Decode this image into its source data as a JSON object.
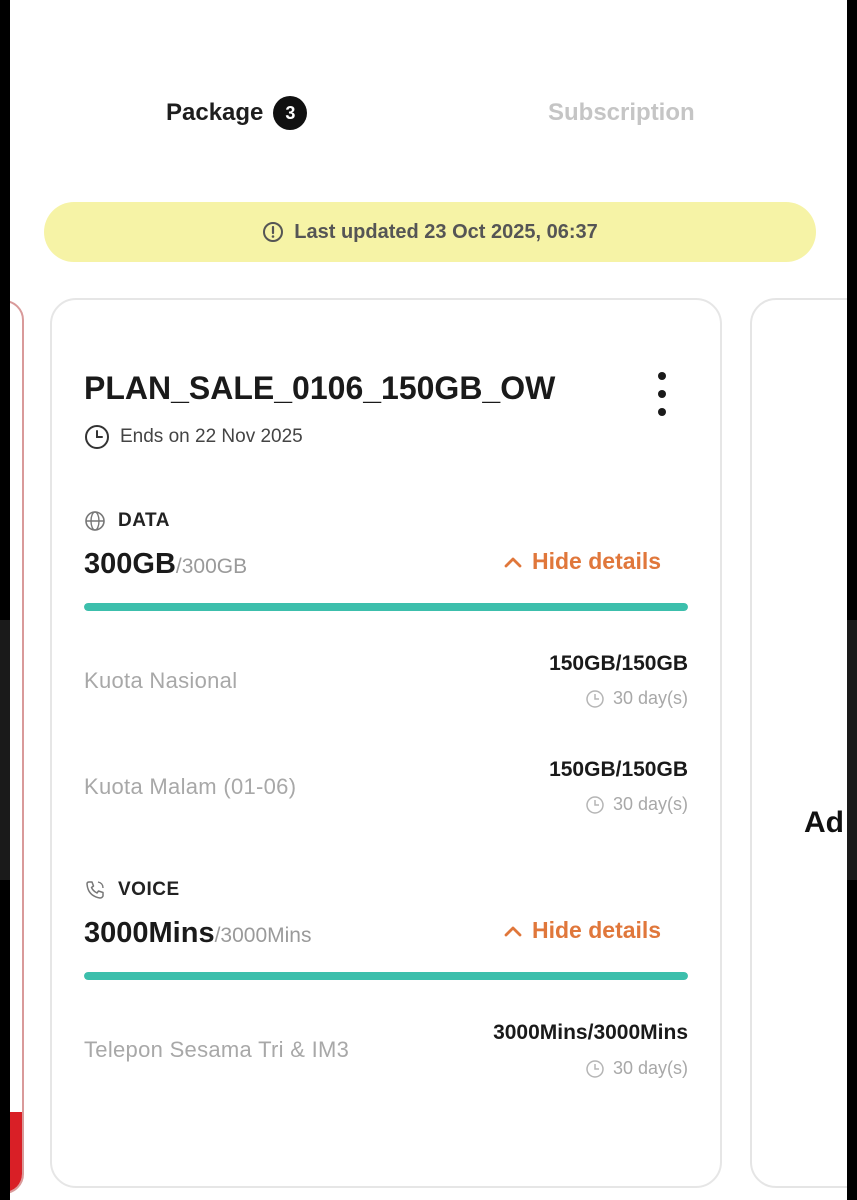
{
  "tabs": {
    "package_label": "Package",
    "package_count": "3",
    "subscription_label": "Subscription"
  },
  "banner": {
    "text": "Last updated 23 Oct 2025, 06:37",
    "icon": "info-icon",
    "color": "#f6f3a6"
  },
  "plan": {
    "name": "PLAN_SALE_0106_150GB_OW",
    "ends": "Ends on 22 Nov 2025",
    "data": {
      "title": "DATA",
      "remaining": "300GB",
      "total": "/300GB",
      "hide_label": "Hide details",
      "fill_fraction": 1.0,
      "items": [
        {
          "label": "Kuota Nasional",
          "value": "150GB/150GB",
          "days": "30 day(s)"
        },
        {
          "label": "Kuota Malam (01-06)",
          "value": "150GB/150GB",
          "days": "30 day(s)"
        }
      ]
    },
    "voice": {
      "title": "VOICE",
      "remaining": "3000Mins",
      "total": "/3000Mins",
      "hide_label": "Hide details",
      "fill_fraction": 1.0,
      "items": [
        {
          "label": "Telepon Sesama Tri & IM3",
          "value": "3000Mins/3000Mins",
          "days": "30 day(s)"
        }
      ]
    }
  },
  "next_card_peek": "Ad",
  "colors": {
    "accent": "#e0773b",
    "progress": "#3cbfac",
    "brand_red": "#d91f26"
  }
}
